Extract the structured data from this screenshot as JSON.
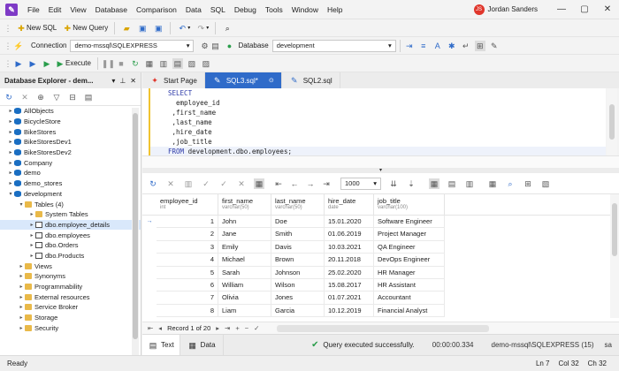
{
  "menu": {
    "items": [
      "File",
      "Edit",
      "View",
      "Database",
      "Comparison",
      "Data",
      "SQL",
      "Debug",
      "Tools",
      "Window",
      "Help"
    ],
    "user": "Jordan Sanders",
    "user_initials": "JS"
  },
  "toolbar1": {
    "new_sql": "New SQL",
    "new_query": "New Query"
  },
  "toolbar2": {
    "connection_label": "Connection",
    "connection_value": "demo-mssql\\SQLEXPRESS",
    "database_label": "Database",
    "database_value": "development"
  },
  "toolbar3": {
    "execute": "Execute"
  },
  "explorer": {
    "title": "Database Explorer - dem...",
    "items": [
      {
        "label": "AllObjects",
        "type": "db",
        "level": 0
      },
      {
        "label": "BicycleStore",
        "type": "db",
        "level": 0
      },
      {
        "label": "BikeStores",
        "type": "db",
        "level": 0
      },
      {
        "label": "BikeStoresDev1",
        "type": "db",
        "level": 0
      },
      {
        "label": "BikeStoresDev2",
        "type": "db",
        "level": 0
      },
      {
        "label": "Company",
        "type": "db",
        "level": 0
      },
      {
        "label": "demo",
        "type": "db",
        "level": 0
      },
      {
        "label": "demo_stores",
        "type": "db",
        "level": 0
      },
      {
        "label": "development",
        "type": "db",
        "level": 0,
        "open": true
      },
      {
        "label": "Tables (4)",
        "type": "folder",
        "level": 1,
        "open": true
      },
      {
        "label": "System Tables",
        "type": "folder",
        "level": 2
      },
      {
        "label": "dbo.employee_details",
        "type": "table",
        "level": 2,
        "selected": true
      },
      {
        "label": "dbo.employees",
        "type": "table",
        "level": 2
      },
      {
        "label": "dbo.Orders",
        "type": "table",
        "level": 2
      },
      {
        "label": "dbo.Products",
        "type": "table",
        "level": 2
      },
      {
        "label": "Views",
        "type": "folder",
        "level": 1
      },
      {
        "label": "Synonyms",
        "type": "folder",
        "level": 1
      },
      {
        "label": "Programmability",
        "type": "folder",
        "level": 1
      },
      {
        "label": "External resources",
        "type": "folder",
        "level": 1
      },
      {
        "label": "Service Broker",
        "type": "folder",
        "level": 1
      },
      {
        "label": "Storage",
        "type": "folder",
        "level": 1
      },
      {
        "label": "Security",
        "type": "folder",
        "level": 1
      }
    ]
  },
  "tabs": [
    {
      "label": "Start Page",
      "active": false
    },
    {
      "label": "SQL3.sql*",
      "active": true
    },
    {
      "label": "SQL2.sql",
      "active": false
    }
  ],
  "editor": {
    "lines": [
      {
        "kw": "SELECT",
        "text": ""
      },
      {
        "kw": "",
        "text": "  employee_id"
      },
      {
        "kw": "",
        "text": " ,first_name"
      },
      {
        "kw": "",
        "text": " ,last_name"
      },
      {
        "kw": "",
        "text": " ,hire_date"
      },
      {
        "kw": "",
        "text": " ,job_title"
      },
      {
        "kw": "FROM",
        "text": " development.dbo.employees;"
      }
    ]
  },
  "results": {
    "page_size": "1000",
    "columns": [
      {
        "name": "employee_id",
        "type": "int"
      },
      {
        "name": "first_name",
        "type": "varchar(50)"
      },
      {
        "name": "last_name",
        "type": "varchar(50)"
      },
      {
        "name": "hire_date",
        "type": "date"
      },
      {
        "name": "job_title",
        "type": "varchar(100)"
      }
    ],
    "rows": [
      [
        "1",
        "John",
        "Doe",
        "15.01.2020",
        "Software Engineer"
      ],
      [
        "2",
        "Jane",
        "Smith",
        "01.06.2019",
        "Project Manager"
      ],
      [
        "3",
        "Emily",
        "Davis",
        "10.03.2021",
        "QA Engineer"
      ],
      [
        "4",
        "Michael",
        "Brown",
        "20.11.2018",
        "DevOps Engineer"
      ],
      [
        "5",
        "Sarah",
        "Johnson",
        "25.02.2020",
        "HR Manager"
      ],
      [
        "6",
        "William",
        "Wilson",
        "15.08.2017",
        "HR Assistant"
      ],
      [
        "7",
        "Olivia",
        "Jones",
        "01.07.2021",
        "Accountant"
      ],
      [
        "8",
        "Liam",
        "Garcia",
        "10.12.2019",
        "Financial Analyst"
      ]
    ],
    "record_nav": "Record 1 of 20",
    "text_tab": "Text",
    "data_tab": "Data",
    "status_msg": "Query executed successfully.",
    "elapsed": "00:00:00.334",
    "server": "demo-mssql\\SQLEXPRESS (15)",
    "user_short": "sa"
  },
  "statusbar": {
    "ready": "Ready",
    "ln": "Ln 7",
    "col": "Col 32",
    "ch": "Ch 32"
  }
}
